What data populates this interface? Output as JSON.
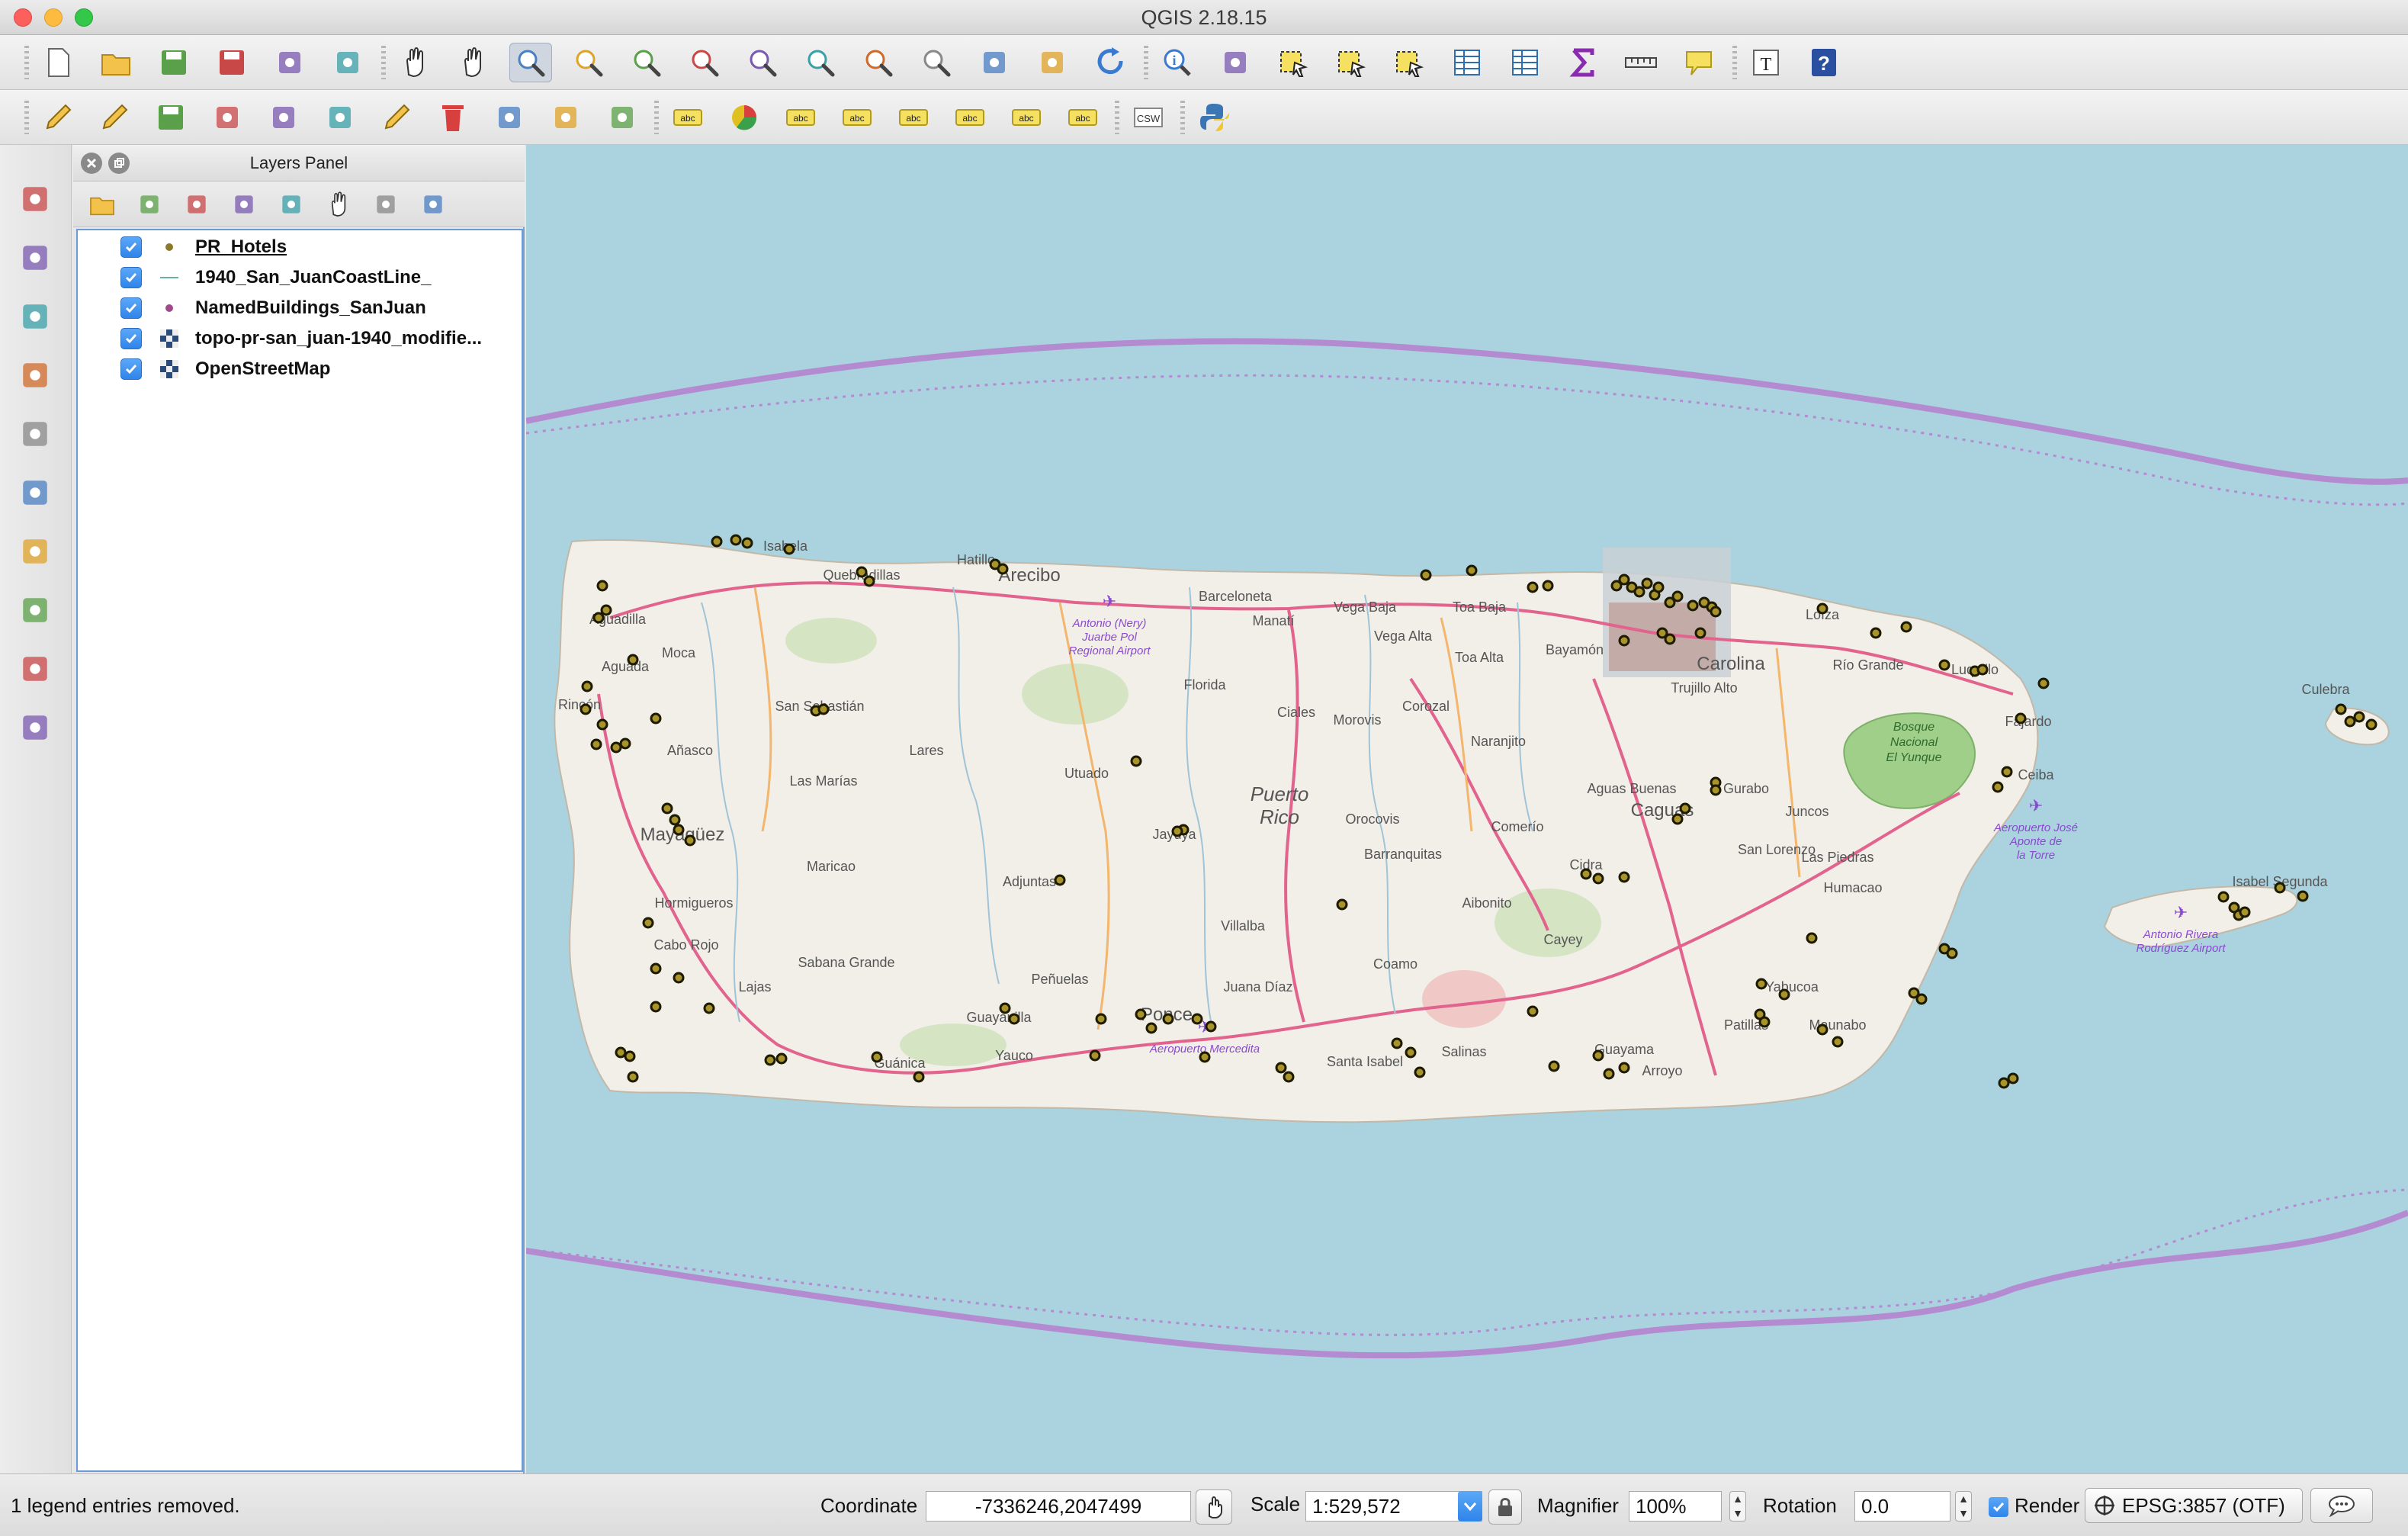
{
  "app": {
    "title": "QGIS 2.18.15"
  },
  "colors": {
    "water": "#aad3df",
    "land": "#f2efe9",
    "road": "#e2638e",
    "boundary": "#b48bd0",
    "hotel": "#1d1a00"
  },
  "toolbar1": {
    "icons": [
      "new-project-icon",
      "open-project-icon",
      "save-project-icon",
      "save-as-icon",
      "new-print-composer-icon",
      "composer-manager-icon",
      "pan-icon",
      "pan-to-selection-icon",
      "zoom-in-icon",
      "zoom-out-icon",
      "zoom-native-icon",
      "zoom-full-icon",
      "zoom-to-selection-icon",
      "zoom-to-layer-icon",
      "zoom-last-icon",
      "zoom-next-icon",
      "new-bookmark-icon",
      "show-bookmarks-icon",
      "refresh-icon",
      "identify-icon",
      "run-feature-action-icon",
      "select-features-icon",
      "select-by-expression-icon",
      "deselect-icon",
      "attribute-table-icon",
      "field-calculator-icon",
      "statistics-sum-icon",
      "measure-line-icon",
      "map-tips-icon",
      "text-annotation-icon",
      "help-icon"
    ]
  },
  "toolbar2": {
    "icons": [
      "current-edits-icon",
      "toggle-editing-icon",
      "save-edits-icon",
      "add-feature-icon",
      "move-feature-icon",
      "node-tool-icon",
      "digitize-icon",
      "delete-selected-icon",
      "cut-features-icon",
      "copy-features-icon",
      "paste-features-icon",
      "label-icon",
      "layer-diagram-icon",
      "label-pin-icon",
      "label-highlight-icon",
      "label-show-icon",
      "label-move-icon",
      "label-rotate-icon",
      "label-change-icon",
      "csw-icon",
      "python-console-icon"
    ],
    "csw_label": "CSW"
  },
  "left_toolbar": {
    "icons": [
      "add-vector-layer-icon",
      "add-raster-layer-icon",
      "add-spatialite-layer-icon",
      "add-postgis-layer-icon",
      "add-wms-layer-icon",
      "add-wcs-layer-icon",
      "add-wfs-layer-icon",
      "add-delimited-text-icon",
      "add-virtual-layer-icon",
      "new-shapefile-icon"
    ]
  },
  "layers_panel": {
    "title": "Layers Panel",
    "tools": [
      "open-styling-icon",
      "add-group-icon",
      "manage-visibility-icon",
      "filter-legend-icon",
      "filter-by-expression-icon",
      "expand-all-icon",
      "collapse-all-icon",
      "remove-layer-icon"
    ],
    "layers": [
      {
        "name": "PR_Hotels",
        "checked": true,
        "symbol": "point"
      },
      {
        "name": "1940_San_JuanCoastLine_",
        "checked": true,
        "symbol": "line"
      },
      {
        "name": "NamedBuildings_SanJuan",
        "checked": true,
        "symbol": "point"
      },
      {
        "name": "topo-pr-san_juan-1940_modifie...",
        "checked": true,
        "symbol": "raster"
      },
      {
        "name": "OpenStreetMap",
        "checked": true,
        "symbol": "raster"
      }
    ]
  },
  "map": {
    "labels": [
      "Isabela",
      "Quebradillas",
      "Hatillo",
      "Arecibo",
      "Barceloneta",
      "Vega Baja",
      "Toa Baja",
      "Manatí",
      "Vega Alta",
      "Toa Alta",
      "Bayamón",
      "Carolina",
      "Trujillo Alto",
      "Loíza",
      "Río Grande",
      "Luquillo",
      "Fajardo",
      "Ceiba",
      "Aguadilla",
      "Aguada",
      "Moca",
      "Rincón",
      "San Sebastián",
      "Añasco",
      "Lares",
      "Las Marías",
      "Mayagüez",
      "Utuado",
      "Florida",
      "Ciales",
      "Morovis",
      "Corozal",
      "Naranjito",
      "Aguas Buenas",
      "Caguas",
      "Gurabo",
      "Juncos",
      "Las Piedras",
      "San Lorenzo",
      "Humacao",
      "Cidra",
      "Comerío",
      "Barranquitas",
      "Aibonito",
      "Orocovis",
      "Jayuya",
      "Adjuntas",
      "Maricao",
      "Hormigueros",
      "Cabo Rojo",
      "Lajas",
      "Sabana Grande",
      "Guánica",
      "Yauco",
      "Guayanilla",
      "Peñuelas",
      "Ponce",
      "Juana Díaz",
      "Villalba",
      "Coamo",
      "Santa Isabel",
      "Salinas",
      "Cayey",
      "Guayama",
      "Arroyo",
      "Patillas",
      "Maunabo",
      "Yabucoa",
      "Culebra",
      "Isabel Segunda"
    ],
    "island_title": [
      "Puerto",
      "Rico"
    ],
    "airport_labels": [
      "Antonio (Nery) Juarbe Pol Regional Airport",
      "Aeropuerto Mercedita",
      "Aeropuerto José Aponte de la Torre",
      "Antonio Rivera Rodríguez Airport"
    ],
    "forest_label": [
      "Bosque",
      "Nacional",
      "El Yunque"
    ]
  },
  "status": {
    "message": "1 legend entries removed.",
    "coordinate_label": "Coordinate",
    "coordinate_value": "-7336246,2047499",
    "scale_label": "Scale",
    "scale_value": "1:529,572",
    "magnifier_label": "Magnifier",
    "magnifier_value": "100%",
    "rotation_label": "Rotation",
    "rotation_value": "0.0",
    "render_label": "Render",
    "render_checked": true,
    "crs_label": "EPSG:3857 (OTF)"
  }
}
